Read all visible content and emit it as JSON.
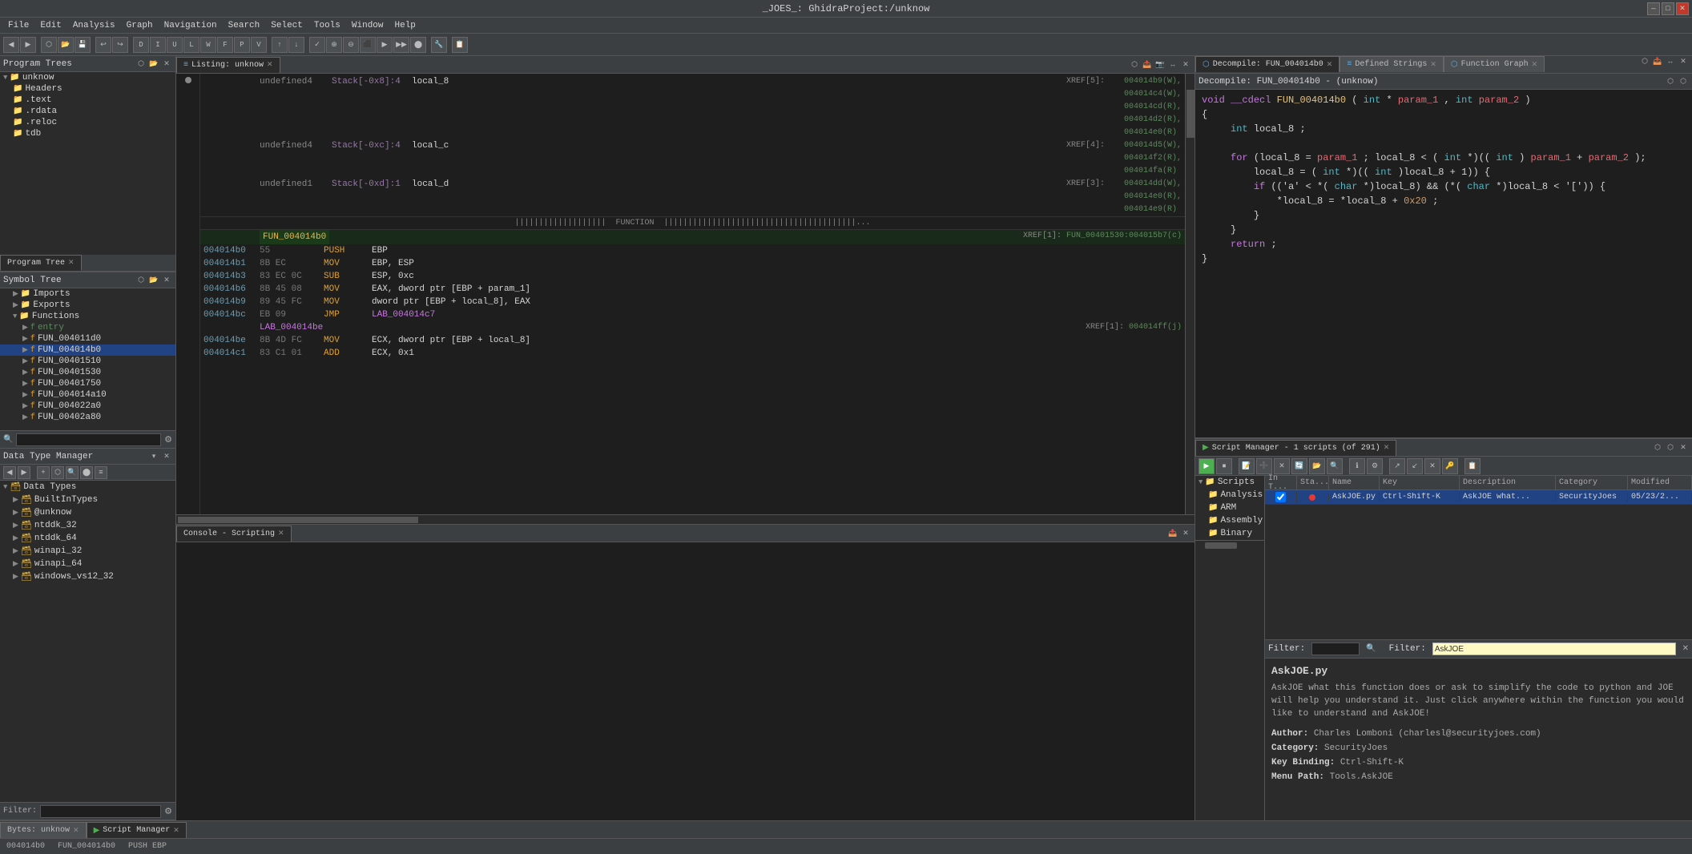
{
  "titleBar": {
    "title": "_JOES_: GhidraProject:/unknow",
    "minimizeLabel": "—",
    "maximizeLabel": "□",
    "closeLabel": "✕"
  },
  "menuBar": {
    "items": [
      "File",
      "Edit",
      "Analysis",
      "Graph",
      "Navigation",
      "Search",
      "Select",
      "Tools",
      "Window",
      "Help"
    ]
  },
  "programTree": {
    "title": "Program Trees",
    "root": "unknow",
    "items": [
      {
        "label": "unknow",
        "indent": 0,
        "type": "root",
        "expanded": true
      },
      {
        "label": "Headers",
        "indent": 1,
        "type": "folder"
      },
      {
        "label": ".text",
        "indent": 1,
        "type": "folder"
      },
      {
        "label": ".rdata",
        "indent": 1,
        "type": "folder"
      },
      {
        "label": ".reloc",
        "indent": 1,
        "type": "folder"
      },
      {
        "label": "tdb",
        "indent": 1,
        "type": "folder"
      }
    ],
    "tabLabel": "Program Tree",
    "filterPlaceholder": ""
  },
  "symbolTree": {
    "title": "Symbol Tree",
    "items": [
      {
        "label": "Imports",
        "indent": 1,
        "type": "folder",
        "expanded": false
      },
      {
        "label": "Exports",
        "indent": 1,
        "type": "folder",
        "expanded": false
      },
      {
        "label": "Functions",
        "indent": 1,
        "type": "folder",
        "expanded": true
      },
      {
        "label": "entry",
        "indent": 2,
        "type": "func",
        "color": "entry"
      },
      {
        "label": "FUN_004011d0",
        "indent": 2,
        "type": "func"
      },
      {
        "label": "FUN_004014b0",
        "indent": 2,
        "type": "func",
        "selected": true
      },
      {
        "label": "FUN_0040151 0",
        "indent": 2,
        "type": "func"
      },
      {
        "label": "FUN_00401530",
        "indent": 2,
        "type": "func"
      },
      {
        "label": "FUN_00401750",
        "indent": 2,
        "type": "func"
      },
      {
        "label": "FUN_004014a10",
        "indent": 2,
        "type": "func"
      },
      {
        "label": "FUN_004022a0",
        "indent": 2,
        "type": "func"
      },
      {
        "label": "FUN_00402a80",
        "indent": 2,
        "type": "func"
      }
    ],
    "filterPlaceholder": ""
  },
  "dataTypeManager": {
    "title": "Data Type Manager",
    "items": [
      {
        "label": "Data Types",
        "indent": 0,
        "type": "root",
        "expanded": true
      },
      {
        "label": "BuiltInTypes",
        "indent": 1,
        "type": "folder"
      },
      {
        "label": "@unknow",
        "indent": 1,
        "type": "folder"
      },
      {
        "label": "ntddk_32",
        "indent": 1,
        "type": "folder"
      },
      {
        "label": "ntddk_64",
        "indent": 1,
        "type": "folder"
      },
      {
        "label": "winapi_32",
        "indent": 1,
        "type": "folder"
      },
      {
        "label": "winapi_64",
        "indent": 1,
        "type": "folder"
      },
      {
        "label": "windows_vs12_32",
        "indent": 1,
        "type": "folder"
      }
    ],
    "filterPlaceholder": ""
  },
  "listing": {
    "title": "Listing: unknow",
    "rows": [
      {
        "type": "vardef",
        "undefined": "undefined4",
        "stack": "Stack[-0x8]:4",
        "local": "local_8",
        "xref": "XREF[5]:",
        "refs": [
          "004014b9(W),",
          "004014c4(W),",
          "004014cd(R),",
          "004014d2(R),",
          "004014e0(R)"
        ]
      },
      {
        "type": "vardef",
        "undefined": "undefined4",
        "stack": "Stack[-0xc]:4",
        "local": "local_c",
        "xref": "XREF[4]:",
        "refs": [
          "004014d5(W),",
          "004014f2(R),",
          "004014fa(R)"
        ]
      },
      {
        "type": "vardef",
        "undefined": "undefined1",
        "stack": "Stack[-0xd]:1",
        "local": "local_d",
        "xref": "XREF[3]:",
        "refs": [
          "004014dd(W),",
          "004014e0(R),",
          "004014e9(R)"
        ]
      },
      {
        "type": "fn_banner",
        "text": "FUNCTION"
      },
      {
        "type": "fn_name",
        "addr": "",
        "name": "FUN_004014b0",
        "xref": "XREF[1]:",
        "ref": "FUN_00401530:004015b7(c)"
      },
      {
        "type": "asm",
        "addr": "004014b0",
        "bytes": "55",
        "mnem": "PUSH",
        "ops": "EBP"
      },
      {
        "type": "asm",
        "addr": "004014b1",
        "bytes": "8B EC",
        "mnem": "MOV",
        "ops": "EBP, ESP"
      },
      {
        "type": "asm",
        "addr": "004014b3",
        "bytes": "83 EC 0C",
        "mnem": "SUB",
        "ops": "ESP, 0xc"
      },
      {
        "type": "asm",
        "addr": "004014b6",
        "bytes": "8B 45 08",
        "mnem": "MOV",
        "ops": "EAX, dword ptr [EBP + param_1]"
      },
      {
        "type": "asm",
        "addr": "004014b9",
        "bytes": "89 45 FC",
        "mnem": "MOV",
        "ops": "dword ptr [EBP + local_8], EAX"
      },
      {
        "type": "asm",
        "addr": "004014bc",
        "bytes": "EB 09",
        "mnem": "JMP",
        "ops": "LAB_004014c7"
      },
      {
        "type": "label",
        "addr": "",
        "name": "LAB_004014be",
        "xref": "XREF[1]:",
        "ref": "004014ff(j)"
      },
      {
        "type": "asm",
        "addr": "004014be",
        "bytes": "8B 4D FC",
        "mnem": "MOV",
        "ops": "ECX, dword ptr [EBP + local_8]"
      },
      {
        "type": "asm",
        "addr": "004014c1",
        "bytes": "83 C1 01",
        "mnem": "ADD",
        "ops": "ECX, 0x1"
      }
    ]
  },
  "console": {
    "title": "Console - Scripting"
  },
  "decompile": {
    "title": "Decompile: FUN_004014b0 - (unknow)",
    "tabLabel": "Decompile: FUN_004014b0",
    "code": [
      {
        "type": "signature",
        "text": "void __cdecl FUN_004014b0(int *param_1,int param_2)"
      },
      {
        "type": "brace",
        "text": "{"
      },
      {
        "type": "decl",
        "text": "  int local_8;"
      },
      {
        "type": "blank"
      },
      {
        "type": "for",
        "text": "  for (local_8 = param_1; local_8 < (int *)((int)param_1 + param_2);"
      },
      {
        "type": "for2",
        "text": "      local_8 = (int *)((int)local_8 + 1)) {"
      },
      {
        "type": "if",
        "text": "    if (('a' < *(char *)local_8) && (*(char *)local_8 < '[')) {"
      },
      {
        "type": "assign",
        "text": "      *local_8 = *local_8 + 0x20;"
      },
      {
        "type": "close_if",
        "text": "    }"
      },
      {
        "type": "close_for",
        "text": "  }"
      },
      {
        "type": "return",
        "text": "  return;"
      },
      {
        "type": "brace",
        "text": "}"
      }
    ]
  },
  "tabs": {
    "decompile": "Decompile: FUN_004014b0",
    "definedStrings": "Defined Strings",
    "functionGraph": "Function Graph"
  },
  "scriptManager": {
    "title": "Script Manager - 1 scripts (of 291)",
    "treeItems": [
      {
        "label": "Scripts",
        "expanded": true
      },
      {
        "label": "Analysis",
        "indent": 1
      },
      {
        "label": "ARM",
        "indent": 1
      },
      {
        "label": "Assembly",
        "indent": 1
      },
      {
        "label": "Binary",
        "indent": 1
      }
    ],
    "listHeaders": [
      "In T...",
      "Sta...",
      "Name",
      "Key",
      "Description",
      "Category",
      "Modified"
    ],
    "scripts": [
      {
        "inTool": true,
        "status": "red",
        "name": "AskJOE.py",
        "key": "Ctrl-Shift-K",
        "description": "AskJOE what...",
        "category": "SecurityJoes",
        "modified": "05/23/2..."
      }
    ],
    "selectedScript": {
      "name": "AskJOE.py",
      "description": "AskJOE what this function does or ask to simplify the code to python and JOE will help you understand it. Just click anywhere within the function you would like to understand and AskJOE!",
      "author": "Charles Lomboni (charlesl@securityjoes.com)",
      "category": "SecurityJoes",
      "keyBinding": "Ctrl-Shift-K",
      "menuPath": "Tools.AskJOE"
    },
    "filterLabel": "Filter:",
    "filterValue": "",
    "filterLabel2": "Filter:",
    "filterValue2": "AskJOE"
  },
  "bottomTabs": [
    {
      "label": "Bytes: unknow",
      "active": false
    },
    {
      "label": "Script Manager",
      "active": true
    }
  ],
  "statusBar": {
    "addr": "004014b0",
    "func": "FUN_004014b0",
    "instr": "PUSH EBP"
  }
}
